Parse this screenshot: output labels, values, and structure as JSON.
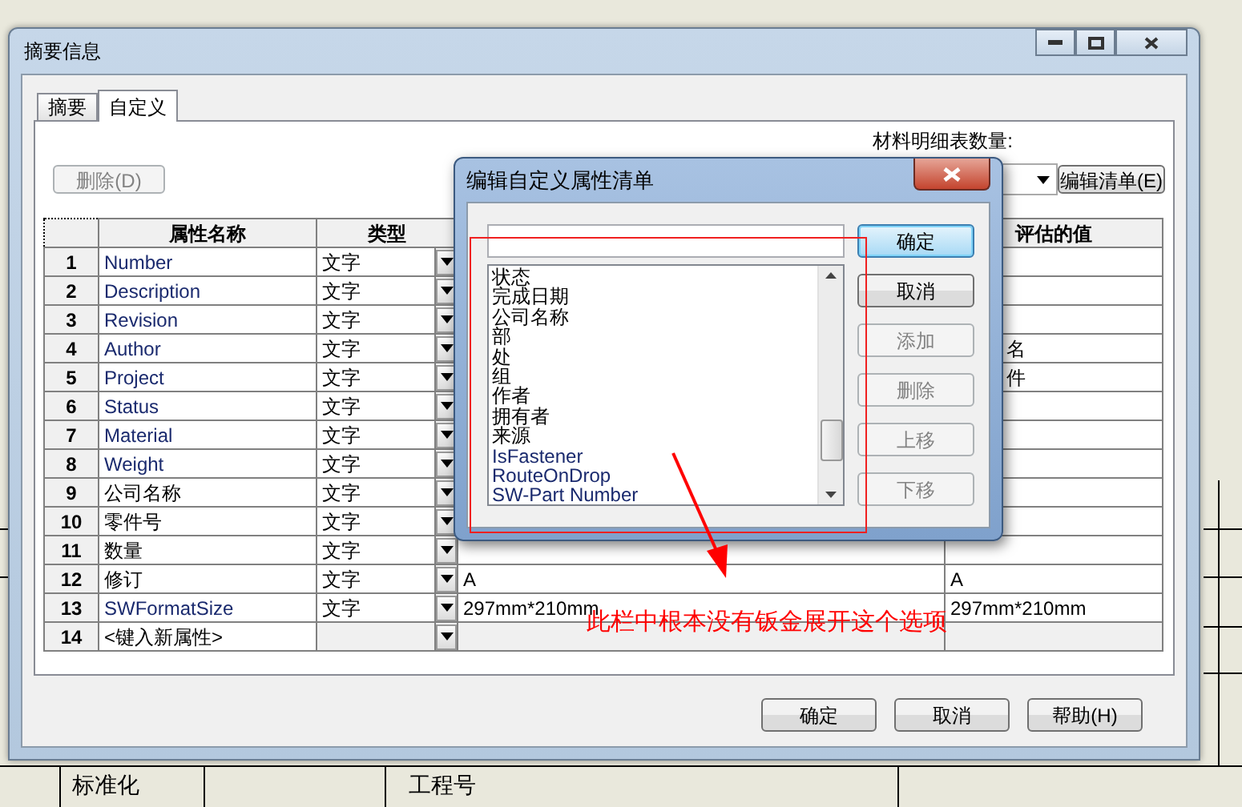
{
  "background_drawing": {
    "labels": [
      "标准化",
      "工程号"
    ]
  },
  "window": {
    "title": "摘要信息"
  },
  "tabs": [
    {
      "label": "摘要",
      "selected": false
    },
    {
      "label": "自定义",
      "selected": true
    }
  ],
  "bom_quantity": {
    "label": "材料明细表数量:"
  },
  "delete_button": {
    "label": "删除(D)",
    "disabled": true
  },
  "edit_list_button": {
    "label": "编辑清单(E)"
  },
  "table": {
    "columns": [
      "属性名称",
      "类型",
      "评估的值"
    ],
    "rows": [
      {
        "number": "1",
        "name": "Number",
        "type": "文字"
      },
      {
        "number": "2",
        "name": "Description",
        "type": "文字"
      },
      {
        "number": "3",
        "name": "Revision",
        "type": "文字"
      },
      {
        "number": "4",
        "name": "Author",
        "type": "文字",
        "evaluated": "名",
        "evaluated_covered": true
      },
      {
        "number": "5",
        "name": "Project",
        "type": "文字",
        "evaluated": "件",
        "evaluated_covered": true
      },
      {
        "number": "6",
        "name": "Status",
        "type": "文字"
      },
      {
        "number": "7",
        "name": "Material",
        "type": "文字"
      },
      {
        "number": "8",
        "name": "Weight",
        "type": "文字"
      },
      {
        "number": "9",
        "name": "公司名称",
        "type": "文字"
      },
      {
        "number": "10",
        "name": "零件号",
        "type": "文字"
      },
      {
        "number": "11",
        "name": "数量",
        "type": "文字"
      },
      {
        "number": "12",
        "name": "修订",
        "type": "文字",
        "value": "A",
        "evaluated": "A"
      },
      {
        "number": "13",
        "name": "SWFormatSize",
        "type": "文字",
        "value": "297mm*210mm",
        "evaluated": "297mm*210mm"
      },
      {
        "number": "14",
        "name": "<键入新属性>"
      }
    ]
  },
  "footer_buttons": [
    "确定",
    "取消",
    "帮助(H)"
  ],
  "dialog": {
    "title": "编辑自定义属性清单",
    "items": [
      "状态",
      "完成日期",
      "公司名称",
      "部",
      "处",
      "组",
      "作者",
      "拥有者",
      "来源",
      "IsFastener",
      "RouteOnDrop",
      "SW-Part Number"
    ],
    "buttons": [
      {
        "label": "确定",
        "disabled": false,
        "default": true
      },
      {
        "label": "取消",
        "disabled": false,
        "default": false
      },
      {
        "label": "添加",
        "disabled": true,
        "default": false
      },
      {
        "label": "删除",
        "disabled": true,
        "default": false
      },
      {
        "label": "上移",
        "disabled": true,
        "default": false
      },
      {
        "label": "下移",
        "disabled": true,
        "default": false
      }
    ]
  },
  "annotation": {
    "text": "此栏中根本没有钣金展开这个选项"
  }
}
